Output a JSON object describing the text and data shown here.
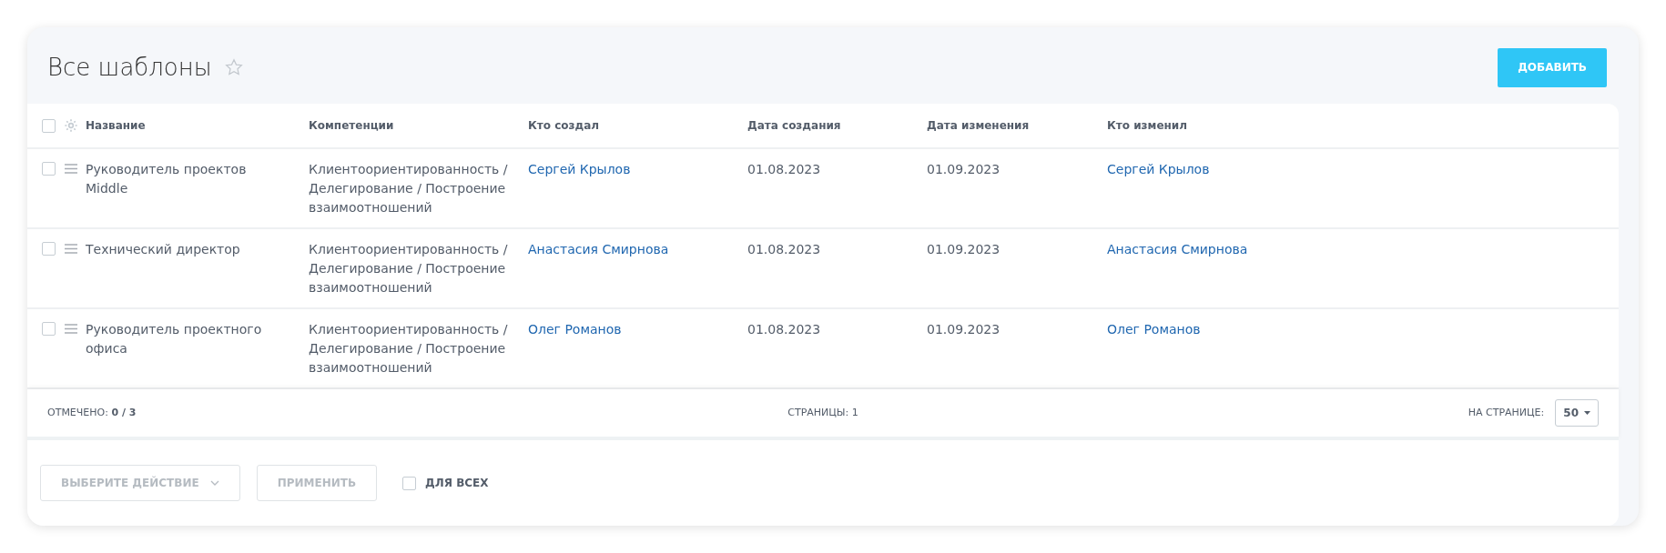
{
  "header": {
    "title": "Все шаблоны",
    "favorite": false,
    "add_button": "ДОБАВИТЬ"
  },
  "table": {
    "select_all_checked": false,
    "columns": [
      "Название",
      "Компетенции",
      "Кто создал",
      "Дата создания",
      "Дата изменения",
      "Кто изменил"
    ],
    "rows": [
      {
        "checked": false,
        "name": "Руководитель проектов Middle",
        "competencies": "Клиентоориентированность / Делегирование / Построение взаимоотношений",
        "created_by": "Сергей Крылов",
        "created": "01.08.2023",
        "modified": "01.09.2023",
        "modified_by": "Сергей Крылов"
      },
      {
        "checked": false,
        "name": "Технический директор",
        "competencies": "Клиентоориентированность / Делегирование / Построение взаимоотношений",
        "created_by": "Анастасия Смирнова",
        "created": "01.08.2023",
        "modified": "01.09.2023",
        "modified_by": "Анастасия Смирнова"
      },
      {
        "checked": false,
        "name": "Руководитель проектного офиса",
        "competencies": "Клиентоориентированность / Делегирование / Построение взаимоотношений",
        "created_by": "Олег Романов",
        "created": "01.08.2023",
        "modified": "01.09.2023",
        "modified_by": "Олег Романов"
      }
    ]
  },
  "footer": {
    "selected": "ОТМЕЧЕНО: **0 / 3**",
    "pages": "СТРАНИЦЫ: 1",
    "per_page_label": "НА СТРАНИЦЕ:",
    "per_page": "50"
  },
  "actions": {
    "action_select": {
      "placeholder": "ВЫБЕРИТЕ ДЕЙСТВИЕ",
      "disabled": true
    },
    "apply_button": {
      "label": "ПРИМЕНИТЬ",
      "disabled": true
    },
    "for_all": {
      "label": "ДЛЯ ВСЕХ",
      "checked": false
    }
  }
}
